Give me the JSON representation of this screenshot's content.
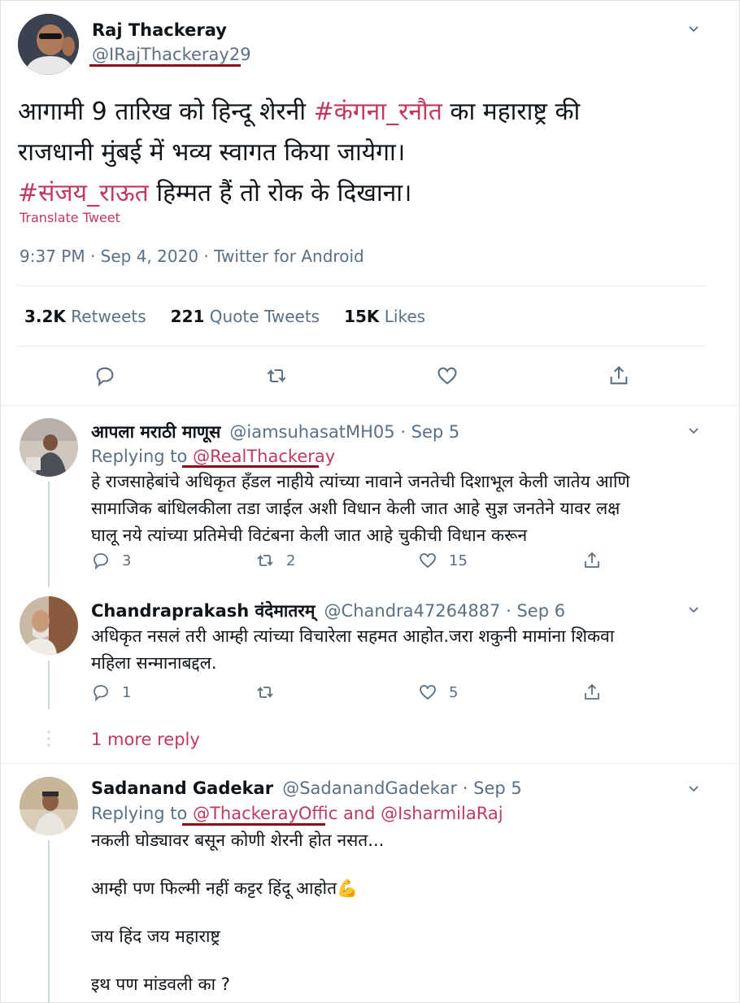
{
  "main_tweet": {
    "name": "Raj Thackeray",
    "handle": "@IRajThackeray29",
    "text_line1_a": "आगामी 9 तारिख को हिन्दू शेरनी ",
    "text_line1_tag": "#कंगना_रनौत",
    "text_line1_b": " का महाराष्ट्र की",
    "text_line2": "राजधानी मुंबई में भव्य स्वागत किया जायेगा।",
    "text_line3_tag": "#संजय_राऊत",
    "text_line3_b": " हिम्मत हैं तो रोक के दिखाना।",
    "translate_label": "Translate Tweet",
    "meta": "9:37 PM · Sep 4, 2020 · Twitter for Android",
    "stats": {
      "retweets_count": "3.2K",
      "retweets_label": "Retweets",
      "quotes_count": "221",
      "quotes_label": "Quote Tweets",
      "likes_count": "15K",
      "likes_label": "Likes"
    }
  },
  "replies": [
    {
      "name": "आपला मराठी माणूस",
      "handle_date": "@iamsuhasatMH05 · Sep 5",
      "replying_prefix": "Replying to ",
      "replying_to": "@RealThackeray",
      "lines": [
        "हे राजसाहेबांचे अधिकृत हँडल नाहीये त्यांच्या नावाने जनतेची दिशाभूल केली जातेय आणि",
        "सामाजिक बांधिलकीला तडा जाईल अशी विधान केली जात आहे सुज्ञ जनतेने यावर लक्ष",
        "घालू नये त्यांच्या प्रतिमेची विटंबना केली जात आहे चुकीची विधान करून"
      ],
      "reply_count": "3",
      "retweet_count": "2",
      "like_count": "15"
    },
    {
      "name": "Chandraprakash वंदेमातरम्",
      "handle_date": "@Chandra47264887 · Sep 6",
      "lines": [
        "अधिकृत नसलं तरी आम्ही त्यांच्या विचारेला सहमत आहोत.जरा शकुनी मामांना शिकवा",
        "महिला सन्मानाबद्दल."
      ],
      "reply_count": "1",
      "retweet_count": "",
      "like_count": "5"
    },
    {
      "name": "Sadanand Gadekar",
      "handle_date": "@SadanandGadekar · Sep 5",
      "replying_prefix": "Replying to ",
      "replying_to": "@ThackerayOffic and @IsharmilaRaj",
      "lines": [
        "नकली घोड्यावर बसून कोणी शेरनी होत नसत...",
        "आम्ही पण फिल्मी नहीं कट्टर हिंदू आहोत💪",
        "जय हिंद जय महाराष्ट्र",
        "इथ पण मांडवली का ?"
      ]
    }
  ],
  "more_replies": "1 more reply",
  "icons": {
    "reply": "reply-icon",
    "retweet": "retweet-icon",
    "like": "heart-icon",
    "share": "share-icon",
    "more": "chevron-down-icon"
  },
  "colors": {
    "hashtag": "#c0395f",
    "link_muted": "#5b7083",
    "underline_annotation": "#8b0e14"
  }
}
